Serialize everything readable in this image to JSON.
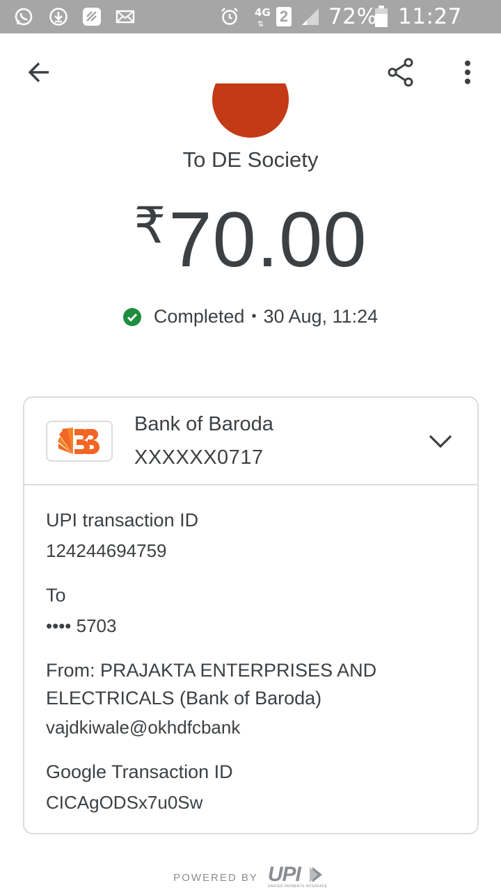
{
  "status_bar": {
    "network": "4G",
    "sim": "2",
    "battery": "72%",
    "time": "11:27 am",
    "icons": [
      "whatsapp-icon",
      "download-icon",
      "gallery-icon",
      "mail-icon",
      "alarm-icon",
      "signal-icon",
      "battery-icon"
    ]
  },
  "app_bar": {
    "icons": [
      "back-arrow-icon",
      "share-icon",
      "more-vert-icon"
    ]
  },
  "payee": "To DE Society",
  "amount": {
    "currency": "₹",
    "value": "70.00"
  },
  "status": {
    "label": "Completed",
    "separator": "•",
    "datetime": "30 Aug, 11:24",
    "color": "#1e8e3e"
  },
  "bank": {
    "name": "Bank of Baroda",
    "account": "XXXXXX0717",
    "brand_color": "#f26522"
  },
  "details": {
    "upi_label": "UPI transaction ID",
    "upi_value": "124244694759",
    "to_label": "To",
    "to_value": "•••• 5703",
    "from_line1": "From: PRAJAKTA ENTERPRISES AND",
    "from_line2": "ELECTRICALS (Bank of Baroda)",
    "from_vpa": "vajdkiwale@okhdfcbank",
    "google_label": "Google Transaction ID",
    "google_value": "CICAgODSx7u0Sw"
  },
  "footer": {
    "powered_by": "POWERED BY",
    "upi_logo_text": "UPI",
    "upi_tagline": "UNIFIED PAYMENTS INTERFACE"
  }
}
